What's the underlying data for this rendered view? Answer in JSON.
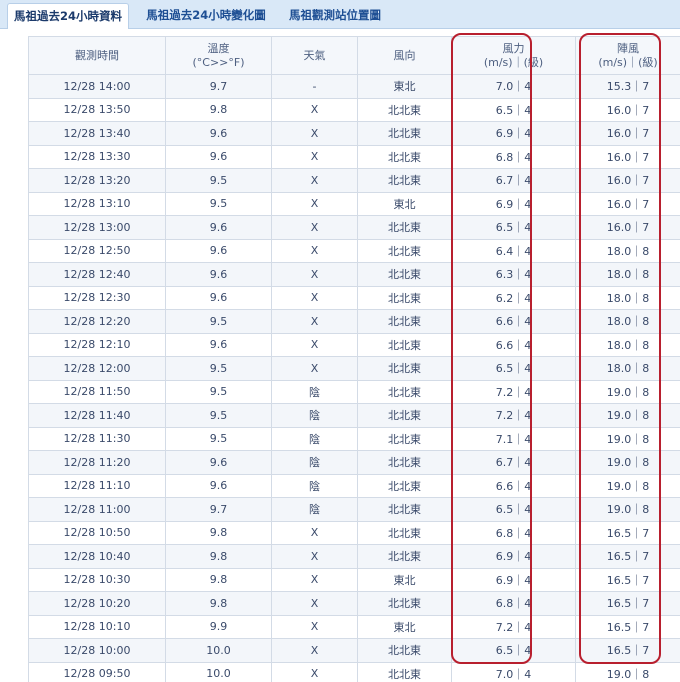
{
  "tabs": [
    {
      "label": "馬祖過去24小時資料",
      "active": true
    },
    {
      "label": "馬祖過去24小時變化圖",
      "active": false
    },
    {
      "label": "馬祖觀測站位置圖",
      "active": false
    }
  ],
  "table": {
    "headers": [
      {
        "line1": "觀測時間",
        "line2": ""
      },
      {
        "line1": "溫度",
        "line2": "(°C>>°F)"
      },
      {
        "line1": "天氣",
        "line2": ""
      },
      {
        "line1": "風向",
        "line2": ""
      },
      {
        "line1": "風力",
        "line2": "(m/s)｜(級)"
      },
      {
        "line1": "陣風",
        "line2": "(m/s)｜(級)"
      }
    ],
    "rows": [
      [
        "12/28 14:00",
        "9.7",
        "-",
        "東北",
        "7.0｜4",
        "15.3｜7"
      ],
      [
        "12/28 13:50",
        "9.8",
        "X",
        "北北東",
        "6.5｜4",
        "16.0｜7"
      ],
      [
        "12/28 13:40",
        "9.6",
        "X",
        "北北東",
        "6.9｜4",
        "16.0｜7"
      ],
      [
        "12/28 13:30",
        "9.6",
        "X",
        "北北東",
        "6.8｜4",
        "16.0｜7"
      ],
      [
        "12/28 13:20",
        "9.5",
        "X",
        "北北東",
        "6.7｜4",
        "16.0｜7"
      ],
      [
        "12/28 13:10",
        "9.5",
        "X",
        "東北",
        "6.9｜4",
        "16.0｜7"
      ],
      [
        "12/28 13:00",
        "9.6",
        "X",
        "北北東",
        "6.5｜4",
        "16.0｜7"
      ],
      [
        "12/28 12:50",
        "9.6",
        "X",
        "北北東",
        "6.4｜4",
        "18.0｜8"
      ],
      [
        "12/28 12:40",
        "9.6",
        "X",
        "北北東",
        "6.3｜4",
        "18.0｜8"
      ],
      [
        "12/28 12:30",
        "9.6",
        "X",
        "北北東",
        "6.2｜4",
        "18.0｜8"
      ],
      [
        "12/28 12:20",
        "9.5",
        "X",
        "北北東",
        "6.6｜4",
        "18.0｜8"
      ],
      [
        "12/28 12:10",
        "9.6",
        "X",
        "北北東",
        "6.6｜4",
        "18.0｜8"
      ],
      [
        "12/28 12:00",
        "9.5",
        "X",
        "北北東",
        "6.5｜4",
        "18.0｜8"
      ],
      [
        "12/28 11:50",
        "9.5",
        "陰",
        "北北東",
        "7.2｜4",
        "19.0｜8"
      ],
      [
        "12/28 11:40",
        "9.5",
        "陰",
        "北北東",
        "7.2｜4",
        "19.0｜8"
      ],
      [
        "12/28 11:30",
        "9.5",
        "陰",
        "北北東",
        "7.1｜4",
        "19.0｜8"
      ],
      [
        "12/28 11:20",
        "9.6",
        "陰",
        "北北東",
        "6.7｜4",
        "19.0｜8"
      ],
      [
        "12/28 11:10",
        "9.6",
        "陰",
        "北北東",
        "6.6｜4",
        "19.0｜8"
      ],
      [
        "12/28 11:00",
        "9.7",
        "陰",
        "北北東",
        "6.5｜4",
        "19.0｜8"
      ],
      [
        "12/28 10:50",
        "9.8",
        "X",
        "北北東",
        "6.8｜4",
        "16.5｜7"
      ],
      [
        "12/28 10:40",
        "9.8",
        "X",
        "北北東",
        "6.9｜4",
        "16.5｜7"
      ],
      [
        "12/28 10:30",
        "9.8",
        "X",
        "東北",
        "6.9｜4",
        "16.5｜7"
      ],
      [
        "12/28 10:20",
        "9.8",
        "X",
        "北北東",
        "6.8｜4",
        "16.5｜7"
      ],
      [
        "12/28 10:10",
        "9.9",
        "X",
        "東北",
        "7.2｜4",
        "16.5｜7"
      ],
      [
        "12/28 10:00",
        "10.0",
        "X",
        "北北東",
        "6.5｜4",
        "16.5｜7"
      ],
      [
        "12/28 09:50",
        "10.0",
        "X",
        "北北東",
        "7.0｜4",
        "19.0｜8"
      ]
    ]
  },
  "colors": {
    "tab_bar": "#d9e8f7",
    "tab_text": "#1e4f94",
    "row_alt": "#f3f6fa",
    "highlight_outline": "#b81f2e"
  }
}
